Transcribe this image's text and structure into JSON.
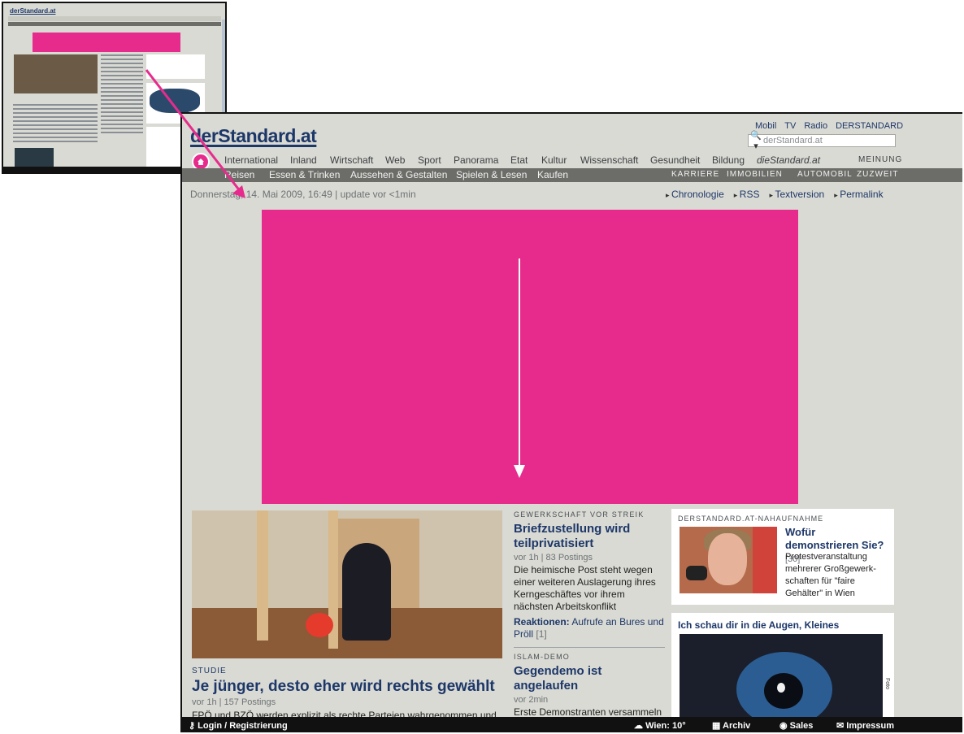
{
  "thumbnail": {
    "logo": "derStandard.at"
  },
  "header": {
    "logo": "derStandard.at",
    "top_links": [
      "Mobil",
      "TV",
      "Radio",
      "DERSTANDARD"
    ],
    "search_placeholder": "derStandard.at"
  },
  "nav_primary": [
    "International",
    "Inland",
    "Wirtschaft",
    "Web",
    "Sport",
    "Panorama",
    "Etat",
    "Kultur",
    "Wissenschaft",
    "Gesundheit",
    "Bildung",
    "dieStandard.at",
    "MEINUNG"
  ],
  "nav_secondary": [
    "Reisen",
    "Essen & Trinken",
    "Aussehen & Gestalten",
    "Spielen & Lesen",
    "Kaufen"
  ],
  "nav_secondary_right": [
    "KARRIERE",
    "IMMOBILIEN",
    "AUTOMOBIL",
    "ZUZWEIT"
  ],
  "dateline": "Donnerstag, 14. Mai 2009, 16:49 | update vor <1min",
  "toolbar": [
    "Chronologie",
    "RSS",
    "Textversion",
    "Permalink"
  ],
  "lead_story": {
    "kicker": "STUDIE",
    "headline": "Je jünger, desto eher wird rechts gewählt",
    "meta": "vor 1h | 157 Postings",
    "teaser": "FPÖ und BZÖ werden explizit als rechte Parteien wahrgenommen und"
  },
  "mid_stories": [
    {
      "kicker": "GEWERKSCHAFT VOR STREIK",
      "headline": "Briefzustellung wird teilprivatisiert",
      "meta": "vor 1h | 83 Postings",
      "text": "Die heimische Post steht wegen einer weiteren Auslagerung ihres Kerngeschäftes vor ihrem nächsten Arbeitskonflikt",
      "related_label": "Reaktionen:",
      "related_text": "Aufrufe an Bures und Pröll",
      "related_count": "[1]"
    },
    {
      "kicker": "ISLAM-DEMO",
      "headline": "Gegendemo ist angelaufen",
      "meta": "vor 2min",
      "text": "Erste Demonstranten versammeln"
    }
  ],
  "nah_box": {
    "kicker": "DERSTANDARD.AT-NAHAUFNAHME",
    "headline": "Wofür demonstrieren Sie?",
    "count": "[30]",
    "text": "Protestveranstaltung mehrerer Großgewerk-schaften für \"faire Gehälter\" in Wien"
  },
  "eye_box": {
    "headline": "Ich schau dir in die Augen, Kleines",
    "side_text": "Foto"
  },
  "bottom_bar": {
    "login": "Login / Registrierung",
    "weather": "Wien: 10°",
    "archive": "Archiv",
    "sales": "Sales",
    "impressum": "Impressum"
  },
  "colors": {
    "ad_magenta": "#e72b8d",
    "brand_navy": "#1d3769",
    "page_bg": "#d9dad3",
    "nav_dark": "#6c6d68"
  }
}
